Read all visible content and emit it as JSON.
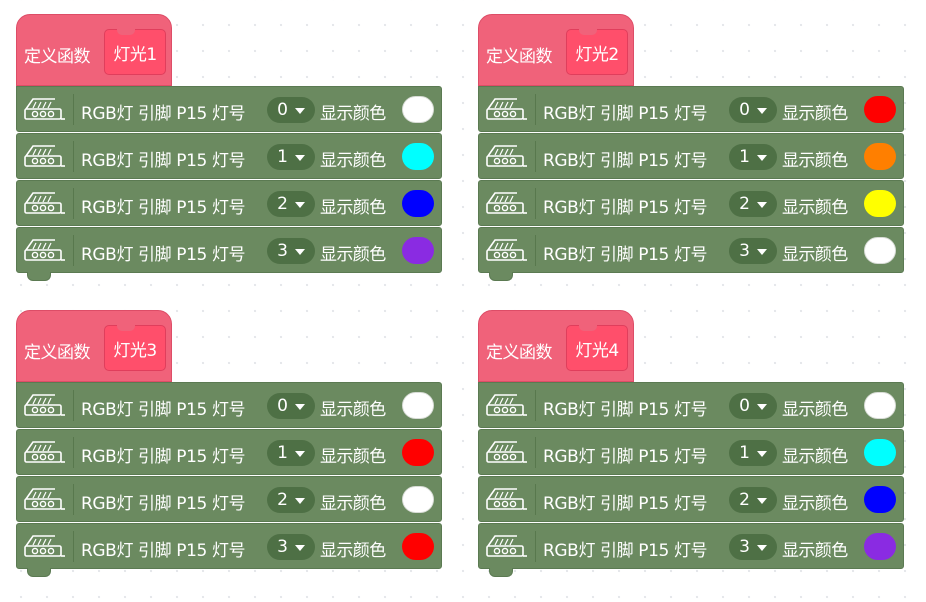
{
  "functions": [
    {
      "define_label": "定义函数",
      "name": "灯光1",
      "rows": [
        {
          "label": "RGB灯 引脚 P15 灯号",
          "index": "0",
          "color_label": "显示颜色",
          "color": "#ffffff"
        },
        {
          "label": "RGB灯 引脚 P15 灯号",
          "index": "1",
          "color_label": "显示颜色",
          "color": "#00ffff"
        },
        {
          "label": "RGB灯 引脚 P15 灯号",
          "index": "2",
          "color_label": "显示颜色",
          "color": "#0000ff"
        },
        {
          "label": "RGB灯 引脚 P15 灯号",
          "index": "3",
          "color_label": "显示颜色",
          "color": "#8a2be2"
        }
      ]
    },
    {
      "define_label": "定义函数",
      "name": "灯光2",
      "rows": [
        {
          "label": "RGB灯 引脚 P15 灯号",
          "index": "0",
          "color_label": "显示颜色",
          "color": "#ff0000"
        },
        {
          "label": "RGB灯 引脚 P15 灯号",
          "index": "1",
          "color_label": "显示颜色",
          "color": "#ff7f00"
        },
        {
          "label": "RGB灯 引脚 P15 灯号",
          "index": "2",
          "color_label": "显示颜色",
          "color": "#ffff00"
        },
        {
          "label": "RGB灯 引脚 P15 灯号",
          "index": "3",
          "color_label": "显示颜色",
          "color": "#ffffff"
        }
      ]
    },
    {
      "define_label": "定义函数",
      "name": "灯光3",
      "rows": [
        {
          "label": "RGB灯 引脚 P15 灯号",
          "index": "0",
          "color_label": "显示颜色",
          "color": "#ffffff"
        },
        {
          "label": "RGB灯 引脚 P15 灯号",
          "index": "1",
          "color_label": "显示颜色",
          "color": "#ff0000"
        },
        {
          "label": "RGB灯 引脚 P15 灯号",
          "index": "2",
          "color_label": "显示颜色",
          "color": "#ffffff"
        },
        {
          "label": "RGB灯 引脚 P15 灯号",
          "index": "3",
          "color_label": "显示颜色",
          "color": "#ff0000"
        }
      ]
    },
    {
      "define_label": "定义函数",
      "name": "灯光4",
      "rows": [
        {
          "label": "RGB灯 引脚 P15 灯号",
          "index": "0",
          "color_label": "显示颜色",
          "color": "#ffffff"
        },
        {
          "label": "RGB灯 引脚 P15 灯号",
          "index": "1",
          "color_label": "显示颜色",
          "color": "#00ffff"
        },
        {
          "label": "RGB灯 引脚 P15 灯号",
          "index": "2",
          "color_label": "显示颜色",
          "color": "#0000ff"
        },
        {
          "label": "RGB灯 引脚 P15 灯号",
          "index": "3",
          "color_label": "显示颜色",
          "color": "#8a2be2"
        }
      ]
    }
  ],
  "icons": {
    "block_icon": "rgb-strip-icon",
    "dropdown_icon": "chevron-down-icon"
  },
  "colors": {
    "hat_block": "#f0627a",
    "function_name_field": "#ff4f6b",
    "command_block": "#6b8a60",
    "dropdown_field": "#4e7045"
  }
}
